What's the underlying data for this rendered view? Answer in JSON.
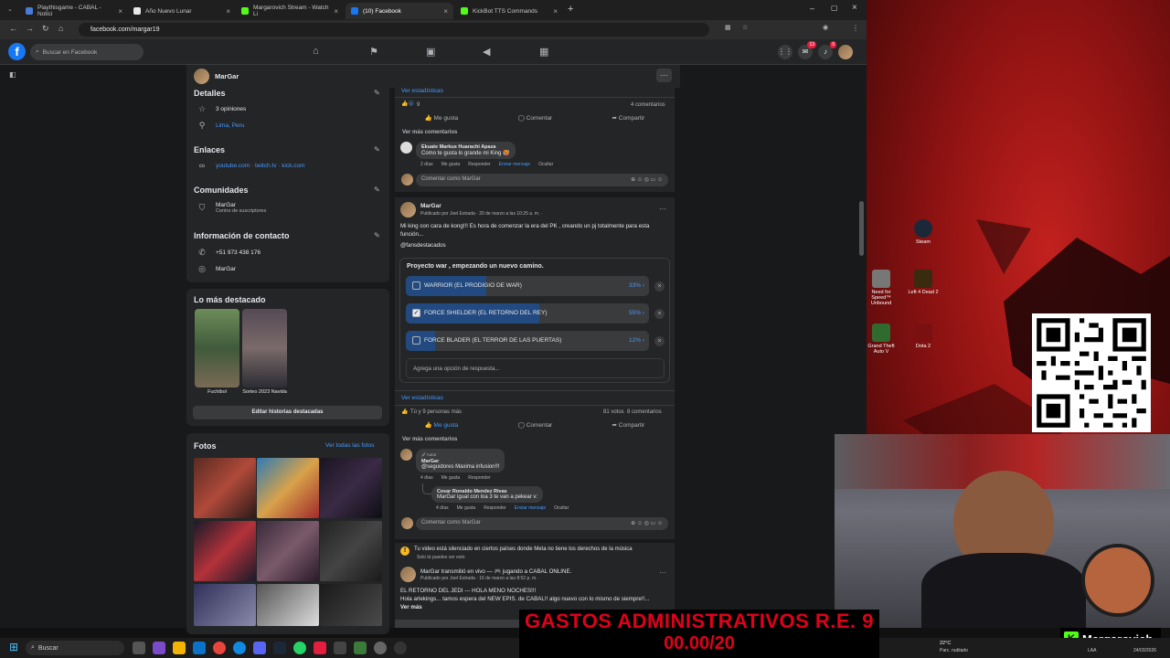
{
  "browser": {
    "tabs": [
      {
        "title": "Playthisgame - CABAL - Notici",
        "color": "#4a7bd8"
      },
      {
        "title": "Año Nuevo Lunar",
        "color": "#e8e8e8"
      },
      {
        "title": "Margarovich Stream - Watch Li",
        "color": "#53fc18"
      },
      {
        "title": "(10) Facebook",
        "color": "#1877f2"
      },
      {
        "title": "KickBot TTS Commands",
        "color": "#53fc18"
      }
    ],
    "url": "facebook.com/margar19"
  },
  "facebook": {
    "search_placeholder": "Buscar en Facebook",
    "messenger_badge": "13",
    "notif_badge": "9",
    "profile_name": "MarGar",
    "details": {
      "title": "Detalles",
      "opinions": "3 opiniones",
      "location": "Lima, Peru"
    },
    "links": {
      "title": "Enlaces",
      "value": "youtube.com · twitch.tv · kick.com"
    },
    "communities": {
      "title": "Comunidades",
      "name": "MarGar",
      "sub": "Centro de suscriptores"
    },
    "contact": {
      "title": "Información de contacto",
      "phone": "+51 973 438 176",
      "messenger": "MarGar"
    },
    "highlights": {
      "title": "Lo más destacado",
      "items": [
        {
          "label": "Fuchibol"
        },
        {
          "label": "Sorteo 2023 Navida"
        }
      ],
      "edit_button": "Editar historias destacadas"
    },
    "photos": {
      "title": "Fotos",
      "see_all": "Ver todas las fotos"
    },
    "post1": {
      "stats_link": "Ver estadísticas",
      "reactions": "9",
      "comments_count": "4 comentarios",
      "like": "Me gusta",
      "comment": "Comentar",
      "share": "Compartir",
      "more_comments": "Ver más comentarios",
      "comment_author": "Ekuate Markus Huarachi Apaza",
      "comment_text": "Como te gusta lo grande mi King 🥵",
      "comment_meta": [
        "2 días",
        "Me gusta",
        "Responder",
        "Enviar mensaje",
        "Ocultar"
      ],
      "comment_as": "Comentar como MarGar"
    },
    "post2": {
      "author": "MarGar",
      "meta": "Publicado por Joel Estrada · 20 de marzo a las 10:25 a. m. ·",
      "text": "Mi king con cara de kong!!! Es hora de comenzar la era del PK , creando un pj totalmente para esta función...",
      "hashtag": "@fansdestacados",
      "poll_title": "Proyecto war , empezando un nuevo camino.",
      "poll_options": [
        {
          "label": "WARRIOR (EL PRODIGIO DE WAR)",
          "pct": "33%",
          "value": 33,
          "checked": false
        },
        {
          "label": "FORCE SHIELDER (EL RETORNO DEL REY)",
          "pct": "55%",
          "value": 55,
          "checked": true
        },
        {
          "label": "FORCE BLADER (EL TERROR DE LAS PUERTAS)",
          "pct": "12%",
          "value": 12,
          "checked": false
        }
      ],
      "add_option_placeholder": "Agrega una opción de respuesta...",
      "stats_link": "Ver estadísticas",
      "reactions": "Tú y 9 personas más",
      "counts": "81 votos  8 comentarios",
      "like": "Me gusta",
      "comment": "Comentar",
      "share": "Compartir",
      "more_comments": "Ver más comentarios",
      "c1_badge": "🖉 Autor",
      "c1_author": "MarGar",
      "c1_text": "@seguidores Maxima infusion!!!",
      "c1_meta": [
        "4 días",
        "Me gusta",
        "Responder"
      ],
      "c2_author": "Cesar Ronaldo Mendez Rivas",
      "c2_text": "MarGar igual con loa 3 te van a pekear v:",
      "c2_meta": [
        "4 días",
        "Me gusta",
        "Responder",
        "Enviar mensaje",
        "Ocultar"
      ],
      "comment_as": "Comentar como MarGar"
    },
    "post3": {
      "warning": "Tu video está silenciado en ciertos países donde Meta no tiene los derechos de la música",
      "warning_sub": "Solo tú puedes ver esto",
      "author_line": "MarGar transmitió en vivo — 🎮 jugando a CABAL ONLINE.",
      "meta": "Publicado por Joel Estrada · 16 de marzo a las 8:52 p. m. ·",
      "text": "EL RETORNO DEL JEDI --- HOLA MENO NOCHES!!!",
      "text2": "Hola arlekings... tamos espera del NEW EPIS. de CABAL!! algo nuevo con lo mismo de siempre!!...",
      "more": "Ver más"
    }
  },
  "desktop": {
    "icons": [
      {
        "label": "Steam"
      },
      {
        "label": "Need for Speed™ Unbound"
      },
      {
        "label": "Left 4 Dead 2"
      },
      {
        "label": "Grand Theft Auto V"
      },
      {
        "label": "Dota 2"
      }
    ]
  },
  "overlay": {
    "line1": "GASTOS ADMINISTRATIVOS R.E. 9",
    "line2": "00.00/20"
  },
  "streamer": {
    "name": "Margarovich"
  },
  "taskbar": {
    "search": "Buscar",
    "weather_temp": "22°C",
    "weather_desc": "Parc. nublado",
    "lang": "LAA",
    "date": "24/03/2026"
  }
}
